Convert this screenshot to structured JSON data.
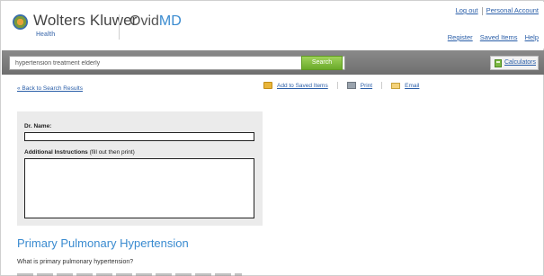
{
  "header": {
    "brand": "Wolters Kluwer",
    "brand_sub": "Health",
    "product_prefix": "Ovid",
    "product_suffix": "MD",
    "top_links": {
      "logout": "Log out",
      "account": "Personal Account"
    },
    "reg_links": {
      "register": "Register",
      "saved": "Saved Items",
      "help": "Help"
    }
  },
  "search": {
    "value": "hypertension treatment elderly",
    "button": "Search",
    "calculators": "Calculators"
  },
  "actions": {
    "back": "« Back to Search Results",
    "add_saved": "Add to Saved Items",
    "print": "Print",
    "email": "Email"
  },
  "form": {
    "name_label": "Dr. Name:",
    "instr_label": "Additional Instructions",
    "instr_hint": " (fill out then print)"
  },
  "article": {
    "title": "Primary Pulmonary Hypertension",
    "question": "What is primary pulmonary hypertension?"
  },
  "colors": {
    "accent": "#3a8bd0",
    "link": "#2a5ea8",
    "search_button": "#6aaa2a",
    "bar": "#7a7a7a"
  }
}
